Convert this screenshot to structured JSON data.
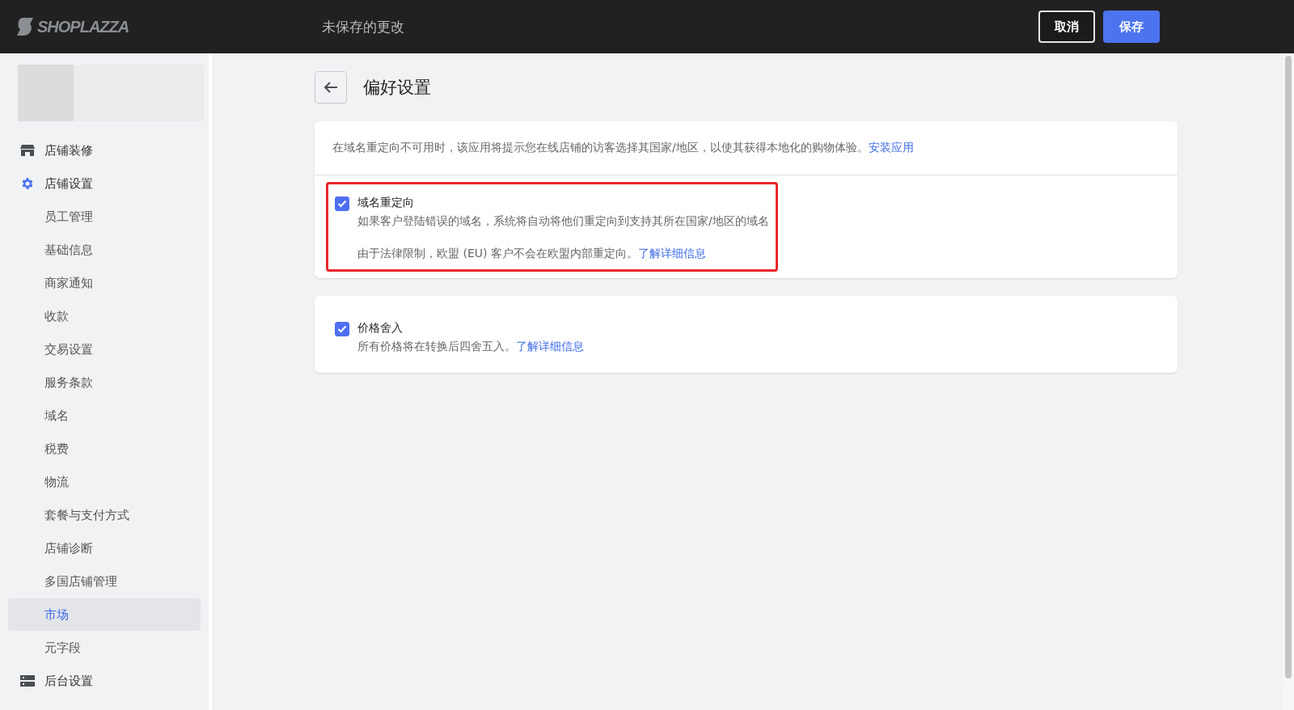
{
  "header": {
    "logo": "SHOPLAZZA",
    "status": "未保存的更改",
    "buttons": [
      {
        "label": "取消",
        "kind": "secondary"
      },
      {
        "label": "保存",
        "kind": "primary"
      }
    ]
  },
  "sidebar": {
    "items": [
      {
        "label": "店铺装修",
        "kind": "store",
        "selected": false
      },
      {
        "label": "店铺设置",
        "kind": "gear",
        "selected": false,
        "children": [
          {
            "label": "员工管理",
            "selected": false
          },
          {
            "label": "基础信息",
            "selected": false
          },
          {
            "label": "商家通知",
            "selected": false
          },
          {
            "label": "收款",
            "selected": false
          },
          {
            "label": "交易设置",
            "selected": false
          },
          {
            "label": "服务条款",
            "selected": false
          },
          {
            "label": "域名",
            "selected": false
          },
          {
            "label": "税费",
            "selected": false
          },
          {
            "label": "物流",
            "selected": false
          },
          {
            "label": "套餐与支付方式",
            "selected": false
          },
          {
            "label": "店铺诊断",
            "selected": false
          },
          {
            "label": "多国店铺管理",
            "selected": false
          },
          {
            "label": "市场",
            "selected": true
          },
          {
            "label": "元字段",
            "selected": false
          }
        ]
      },
      {
        "label": "后台设置",
        "kind": "server",
        "selected": false
      }
    ]
  },
  "page": {
    "title": "偏好设置",
    "cards": [
      {
        "intro": {
          "text": "在域名重定向不可用时，该应用将提示您在线店铺的访客选择其国家/地区，以使其获得本地化的购物体验。",
          "link": "安装应用"
        },
        "setting": {
          "label": "域名重定向",
          "checked": true,
          "highlighted": true,
          "description": "如果客户登陆错误的域名，系统将自动将他们重定向到支持其所在国家/地区的域名",
          "note": "由于法律限制，欧盟 (EU) 客户不会在欧盟内部重定向。",
          "link": "了解详细信息"
        }
      },
      {
        "setting": {
          "label": "价格舍入",
          "checked": true,
          "description": "所有价格将在转换后四舍五入。",
          "link": "了解详细信息"
        }
      }
    ]
  }
}
